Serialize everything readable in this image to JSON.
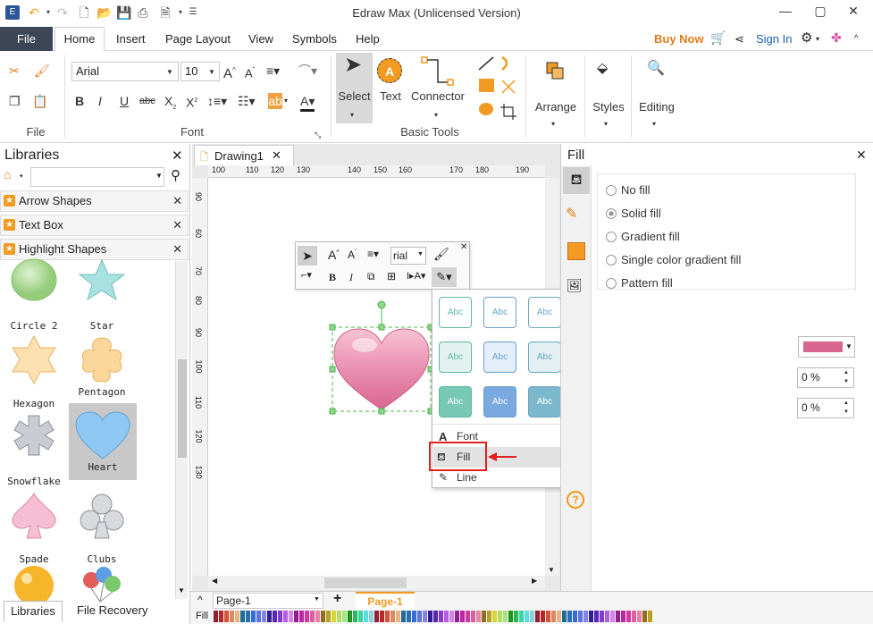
{
  "window": {
    "title": "Edraw Max (Unlicensed Version)"
  },
  "menu": {
    "file": "File",
    "tabs": [
      "Home",
      "Insert",
      "Page Layout",
      "View",
      "Symbols",
      "Help"
    ],
    "buy_now": "Buy Now",
    "sign_in": "Sign In"
  },
  "ribbon": {
    "font_name": "Arial",
    "font_size": "10",
    "groups": {
      "file": "File",
      "font": "Font",
      "basic_tools": "Basic Tools"
    },
    "select": "Select",
    "text": "Text",
    "connector": "Connector",
    "arrange": "Arrange",
    "styles": "Styles",
    "editing": "Editing"
  },
  "libraries": {
    "title": "Libraries",
    "sections": [
      "Arrow Shapes",
      "Text Box",
      "Highlight Shapes"
    ],
    "shapes": [
      "Circle 2",
      "Star",
      "Hexagon",
      "Pentagon ...",
      "Snowflake",
      "Heart",
      "Spade",
      "Clubs"
    ],
    "bottom_tabs": [
      "Libraries",
      "File Recovery"
    ]
  },
  "canvas": {
    "tab": "Drawing1",
    "ruler_h": [
      "100",
      "110",
      "120",
      "130",
      "140",
      "150",
      "160",
      "170",
      "180",
      "190"
    ],
    "ruler_v": [
      "90",
      "60",
      "70",
      "80",
      "90",
      "100",
      "110",
      "120",
      "130"
    ],
    "mini_font": "rial"
  },
  "fill_panel": {
    "title": "Fill",
    "options": [
      "No fill",
      "Solid fill",
      "Gradient fill",
      "Single color gradient fill",
      "Pattern fill"
    ],
    "selected": "Solid fill",
    "color": "#d9668f",
    "percent1": "0 %",
    "percent2": "0 %"
  },
  "style_gallery": {
    "label": "Abc",
    "row1": [
      "#5cb8a8",
      "#6b9fcf",
      "#6aa8c0",
      "#e0876a",
      "#f0b060",
      "#d9749a",
      "#6d7a8f"
    ],
    "row2_bg": [
      "#e3f2ef",
      "#e4eef8",
      "#e4eff3",
      "#fbe9e2",
      "#fdf0dd",
      "#f9e6ee",
      "#e8ebf0"
    ],
    "row3_bg": [
      "#78c9b4",
      "#7aa9e0",
      "#7bb8cc",
      "#f19e7e",
      "#fbc07a",
      "#e699b2",
      "#8a96ab"
    ]
  },
  "context_menu": {
    "items": [
      "Font",
      "Fill",
      "Line"
    ]
  },
  "status": {
    "page_select": "Page-1",
    "page_tab": "Page-1",
    "fill_label": "Fill"
  }
}
